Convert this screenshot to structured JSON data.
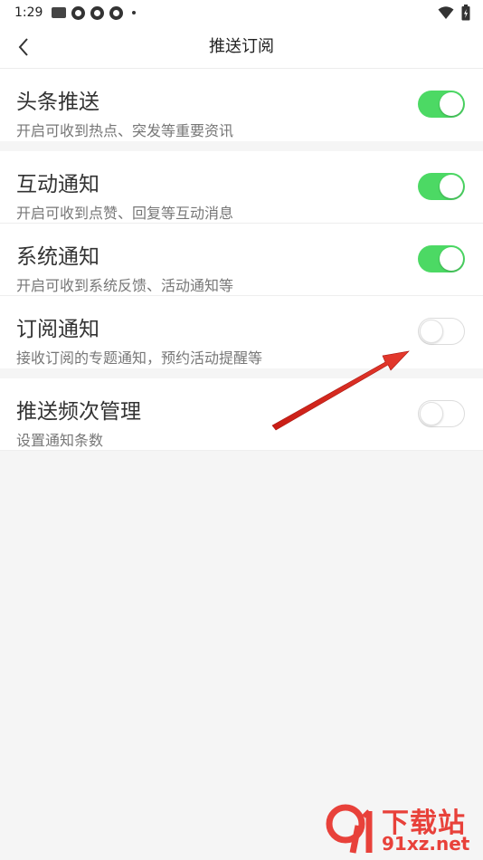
{
  "status_bar": {
    "time": "1:29"
  },
  "nav": {
    "title": "推送订阅"
  },
  "settings": {
    "headline": {
      "title": "头条推送",
      "desc": "开启可收到热点、突发等重要资讯",
      "enabled": true
    },
    "interaction": {
      "title": "互动通知",
      "desc": "开启可收到点赞、回复等互动消息",
      "enabled": true
    },
    "system": {
      "title": "系统通知",
      "desc": "开启可收到系统反馈、活动通知等",
      "enabled": true
    },
    "subscription": {
      "title": "订阅通知",
      "desc": "接收订阅的专题通知，预约活动提醒等",
      "enabled": false
    },
    "frequency": {
      "title": "推送频次管理",
      "desc": "设置通知条数",
      "enabled": false
    }
  },
  "watermark": {
    "top": "下载站",
    "bottom": "91xz.net"
  },
  "colors": {
    "toggle_on": "#4cd964",
    "arrow": "#d9261c",
    "watermark": "#e8413a"
  },
  "icons": {
    "back": "chevron-left-icon",
    "wifi": "wifi-icon",
    "battery": "battery-icon"
  }
}
